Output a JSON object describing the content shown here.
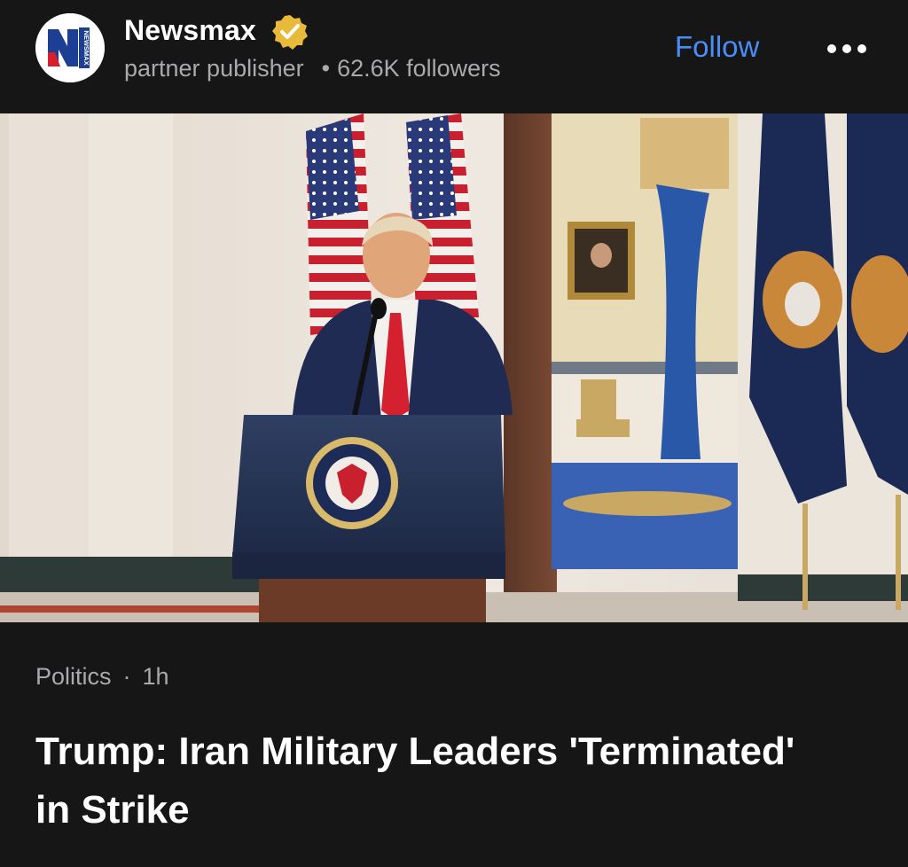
{
  "publisher": {
    "name": "Newsmax",
    "logo_letter": "N",
    "logo_text": "NEWSMAX",
    "subtitle": "partner publisher",
    "separator": "•",
    "followers": "62.6K followers",
    "verified_icon": "verified-badge-icon",
    "colors": {
      "logo_blue": "#1c3f94",
      "logo_red": "#d6202e",
      "badge_gold": "#e9b93a"
    }
  },
  "actions": {
    "follow_label": "Follow",
    "more_icon": "more-dots-icon",
    "follow_color": "#4a8df6"
  },
  "hero_image": {
    "description_icon": "article-photo",
    "seal_text": "SEAL OF THE PRESIDENT OF THE UNITED STATES"
  },
  "article": {
    "category": "Politics",
    "separator": "·",
    "age": "1h",
    "headline": "Trump: Iran Military Leaders 'Terminated' in Strike"
  }
}
